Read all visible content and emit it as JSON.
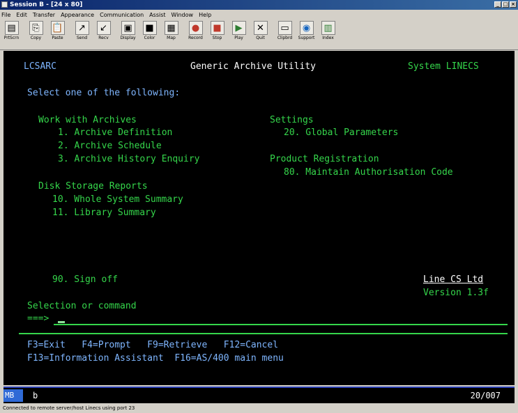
{
  "window": {
    "title": "Session B - [24 x 80]"
  },
  "menubar": [
    "File",
    "Edit",
    "Transfer",
    "Appearance",
    "Communication",
    "Assist",
    "Window",
    "Help"
  ],
  "toolbar": [
    {
      "label": "PrtScrn",
      "icon": "print-screen-icon",
      "glyph": "▤"
    },
    {
      "label": "Copy",
      "icon": "copy-icon",
      "glyph": "⎘"
    },
    {
      "label": "Paste",
      "icon": "paste-icon",
      "glyph": "📋"
    },
    {
      "label": "Send",
      "icon": "send-icon",
      "glyph": "↗"
    },
    {
      "label": "Recv",
      "icon": "receive-icon",
      "glyph": "↙"
    },
    {
      "label": "Display",
      "icon": "display-icon",
      "glyph": "▣"
    },
    {
      "label": "Color",
      "icon": "color-icon",
      "glyph": "■"
    },
    {
      "label": "Map",
      "icon": "map-icon",
      "glyph": "▦"
    },
    {
      "label": "Record",
      "icon": "record-icon",
      "glyph": "●"
    },
    {
      "label": "Stop",
      "icon": "stop-icon",
      "glyph": "■"
    },
    {
      "label": "Play",
      "icon": "play-icon",
      "glyph": "▶"
    },
    {
      "label": "Quit",
      "icon": "quit-icon",
      "glyph": "✕"
    },
    {
      "label": "Clipbrd",
      "icon": "clipboard-icon",
      "glyph": "▭"
    },
    {
      "label": "Support",
      "icon": "support-icon",
      "glyph": "◉"
    },
    {
      "label": "Index",
      "icon": "index-icon",
      "glyph": "▥"
    }
  ],
  "screen": {
    "program": "LCSARC",
    "title": "Generic Archive Utility",
    "system": "System LINECS",
    "instruction": "Select one of the following:",
    "work_header": "Work with Archives",
    "opt1": "1. Archive Definition",
    "opt2": "2. Archive Schedule",
    "opt3": "3. Archive History Enquiry",
    "disk_header": "Disk Storage Reports",
    "opt10": "10. Whole System Summary",
    "opt11": "11. Library Summary",
    "settings_header": "Settings",
    "opt20": "20. Global Parameters",
    "registration_header": "Product Registration",
    "opt80": "80. Maintain Authorisation Code",
    "signoff": "90. Sign off",
    "company": "Line CS Ltd",
    "version": "Version 1.3f",
    "selection_label": "Selection or command",
    "prompt": "===>",
    "fkeys1": "F3=Exit   F4=Prompt   F9=Retrieve   F12=Cancel",
    "fkeys2": "F13=Information Assistant  F16=AS/400 main menu"
  },
  "oia": {
    "mode": "MB",
    "indicator": "b",
    "cursor_position": "20/007"
  },
  "status": "Connected to remote server/host Linecs using port 23",
  "colors": {
    "screen_bg": "#000000",
    "green": "#35d64b",
    "blue": "#7fb6ff",
    "white": "#ffffff",
    "title_gradient_start": "#0a246a"
  }
}
